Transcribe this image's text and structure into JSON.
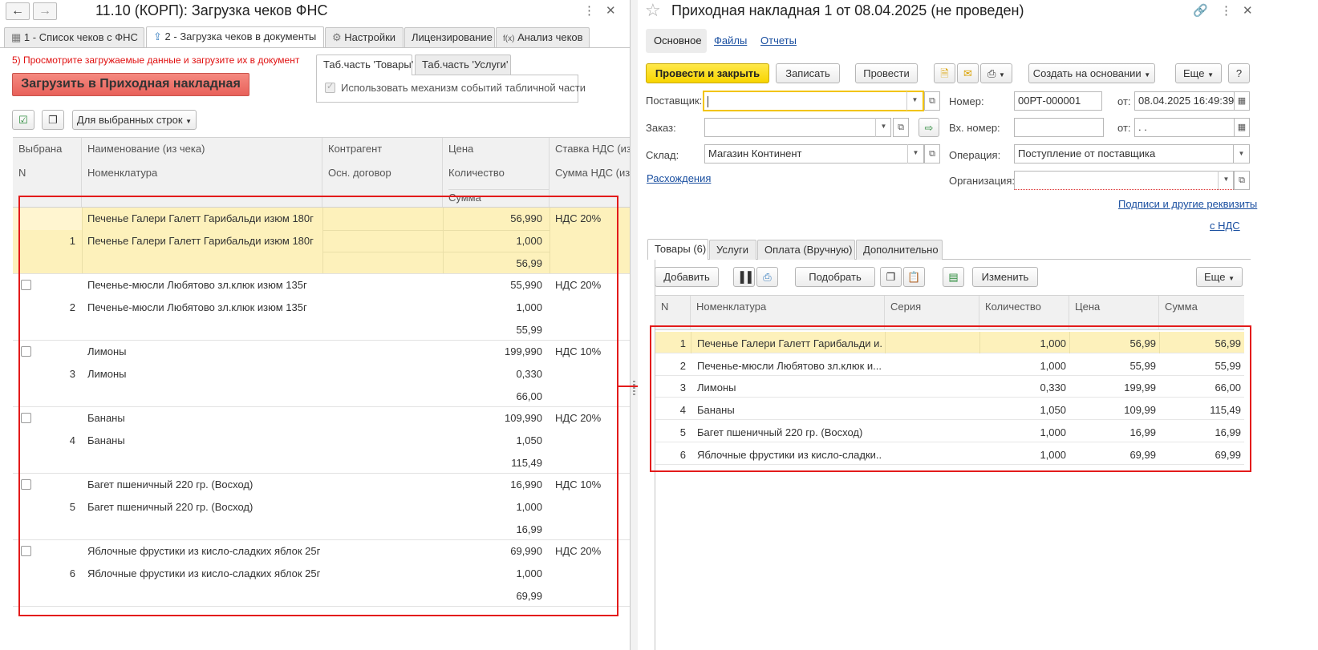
{
  "left": {
    "title": "11.10 (КОРП): Загрузка чеков ФНС",
    "tabs": [
      "1 - Список чеков с ФНС",
      "2 - Загрузка чеков в документы",
      "Настройки",
      "Лицензирование",
      "Анализ чеков"
    ],
    "instruction": "5) Просмотрите загружаемые данные и загрузите их в документ",
    "load_button": "Загрузить в Приходная накладная",
    "subtabs": [
      "Таб.часть 'Товары'",
      "Таб.часть 'Услуги'"
    ],
    "checkbox_label": "Использовать механизм событий табличной части",
    "selected_rows_button": "Для выбранных строк",
    "columns": {
      "selected": "Выбрана",
      "n": "N",
      "name": "Наименование (из чека)",
      "nomenclature": "Номенклатура",
      "counterparty": "Контрагент",
      "contract": "Осн. договор",
      "price": "Цена",
      "quantity": "Количество",
      "sum": "Сумма",
      "vat_rate": "Ставка НДС (из",
      "vat_sum": "Сумма НДС (из"
    },
    "rows": [
      {
        "n": "1",
        "name": "Печенье Галери Галетт Гарибальди изюм 180г",
        "nomen": "Печенье Галери Галетт Гарибальди изюм 180г",
        "price": "56,990",
        "qty": "1,000",
        "sum": "56,99",
        "vat": "НДС 20%"
      },
      {
        "n": "2",
        "name": "Печенье-мюсли Любятово зл.клюк изюм 135г",
        "nomen": "Печенье-мюсли Любятово зл.клюк изюм 135г",
        "price": "55,990",
        "qty": "1,000",
        "sum": "55,99",
        "vat": "НДС 20%"
      },
      {
        "n": "3",
        "name": "Лимоны",
        "nomen": "Лимоны",
        "price": "199,990",
        "qty": "0,330",
        "sum": "66,00",
        "vat": "НДС 10%"
      },
      {
        "n": "4",
        "name": "Бананы",
        "nomen": "Бананы",
        "price": "109,990",
        "qty": "1,050",
        "sum": "115,49",
        "vat": "НДС 20%"
      },
      {
        "n": "5",
        "name": "Багет пшеничный 220 гр. (Восход)",
        "nomen": "Багет пшеничный 220 гр. (Восход)",
        "price": "16,990",
        "qty": "1,000",
        "sum": "16,99",
        "vat": "НДС 10%"
      },
      {
        "n": "6",
        "name": "Яблочные фрустики из кисло-сладких яблок 25г",
        "nomen": "Яблочные фрустики из кисло-сладких яблок 25г",
        "price": "69,990",
        "qty": "1,000",
        "sum": "69,99",
        "vat": "НДС 20%"
      }
    ]
  },
  "right": {
    "title": "Приходная накладная 1 от 08.04.2025 (не проведен)",
    "nav": [
      "Основное",
      "Файлы",
      "Отчеты"
    ],
    "toolbar": {
      "post_close": "Провести и закрыть",
      "save": "Записать",
      "post": "Провести",
      "create_based": "Создать на основании",
      "more": "Еще",
      "help": "?"
    },
    "fields": {
      "supplier_label": "Поставщик:",
      "supplier_value": "",
      "order_label": "Заказ:",
      "order_value": "",
      "warehouse_label": "Склад:",
      "warehouse_value": "Магазин Континент",
      "number_label": "Номер:",
      "number_value": "00РТ-000001",
      "from_label": "от:",
      "date_value": "08.04.2025 16:49:39",
      "in_number_label": "Вх. номер:",
      "in_number_value": "",
      "in_from_label": "от:",
      "in_date_value": " .  .",
      "operation_label": "Операция:",
      "operation_value": "Поступление от поставщика",
      "org_label": "Организация:",
      "org_value": ""
    },
    "links": {
      "discrepancies": "Расхождения",
      "signatures": "Подписи и другие реквизиты",
      "vat": "с НДС"
    },
    "tabs": [
      "Товары (6)",
      "Услуги",
      "Оплата (Вручную)",
      "Дополнительно"
    ],
    "table_toolbar": {
      "add": "Добавить",
      "pick": "Подобрать",
      "change": "Изменить",
      "more": "Еще"
    },
    "columns": {
      "n": "N",
      "nomenclature": "Номенклатура",
      "series": "Серия",
      "quantity": "Количество",
      "price": "Цена",
      "sum": "Сумма"
    },
    "rows": [
      {
        "n": "1",
        "nomen": "Печенье Галери Галетт Гарибальди и...",
        "qty": "1,000",
        "price": "56,99",
        "sum": "56,99"
      },
      {
        "n": "2",
        "nomen": "Печенье-мюсли Любятово зл.клюк и...",
        "qty": "1,000",
        "price": "55,99",
        "sum": "55,99"
      },
      {
        "n": "3",
        "nomen": "Лимоны",
        "qty": "0,330",
        "price": "199,99",
        "sum": "66,00"
      },
      {
        "n": "4",
        "nomen": "Бананы",
        "qty": "1,050",
        "price": "109,99",
        "sum": "115,49"
      },
      {
        "n": "5",
        "nomen": "Багет пшеничный 220 гр. (Восход)",
        "qty": "1,000",
        "price": "16,99",
        "sum": "16,99"
      },
      {
        "n": "6",
        "nomen": "Яблочные фрустики из кисло-сладки...",
        "qty": "1,000",
        "price": "69,99",
        "sum": "69,99"
      }
    ]
  },
  "colors": {
    "highlight": "#fdf1bb",
    "accent_yellow": "#f8d500",
    "red_frame": "#e31b1b",
    "link": "#1a4fa0"
  }
}
